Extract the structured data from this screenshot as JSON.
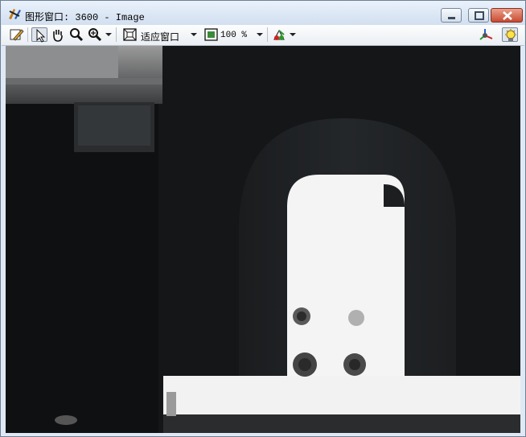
{
  "window": {
    "title": "图形窗口: 3600 - Image",
    "controls": {
      "minimize": "minimize",
      "maximize": "maximize",
      "close": "close"
    }
  },
  "toolbar": {
    "fit_mode_label": "适应窗口",
    "zoom_label": "100 %",
    "icons": [
      "edit-icon",
      "pointer-icon",
      "pan-hand-icon",
      "zoom-icon",
      "zoom-in-icon",
      "fit-window-icon",
      "zoom-level-icon",
      "color-picker-icon",
      "axis-3d-icon",
      "light-bulb-icon"
    ]
  },
  "image_view": {
    "description_colors": {
      "background": "#121416",
      "bright_region": "#f4f4f4"
    }
  }
}
